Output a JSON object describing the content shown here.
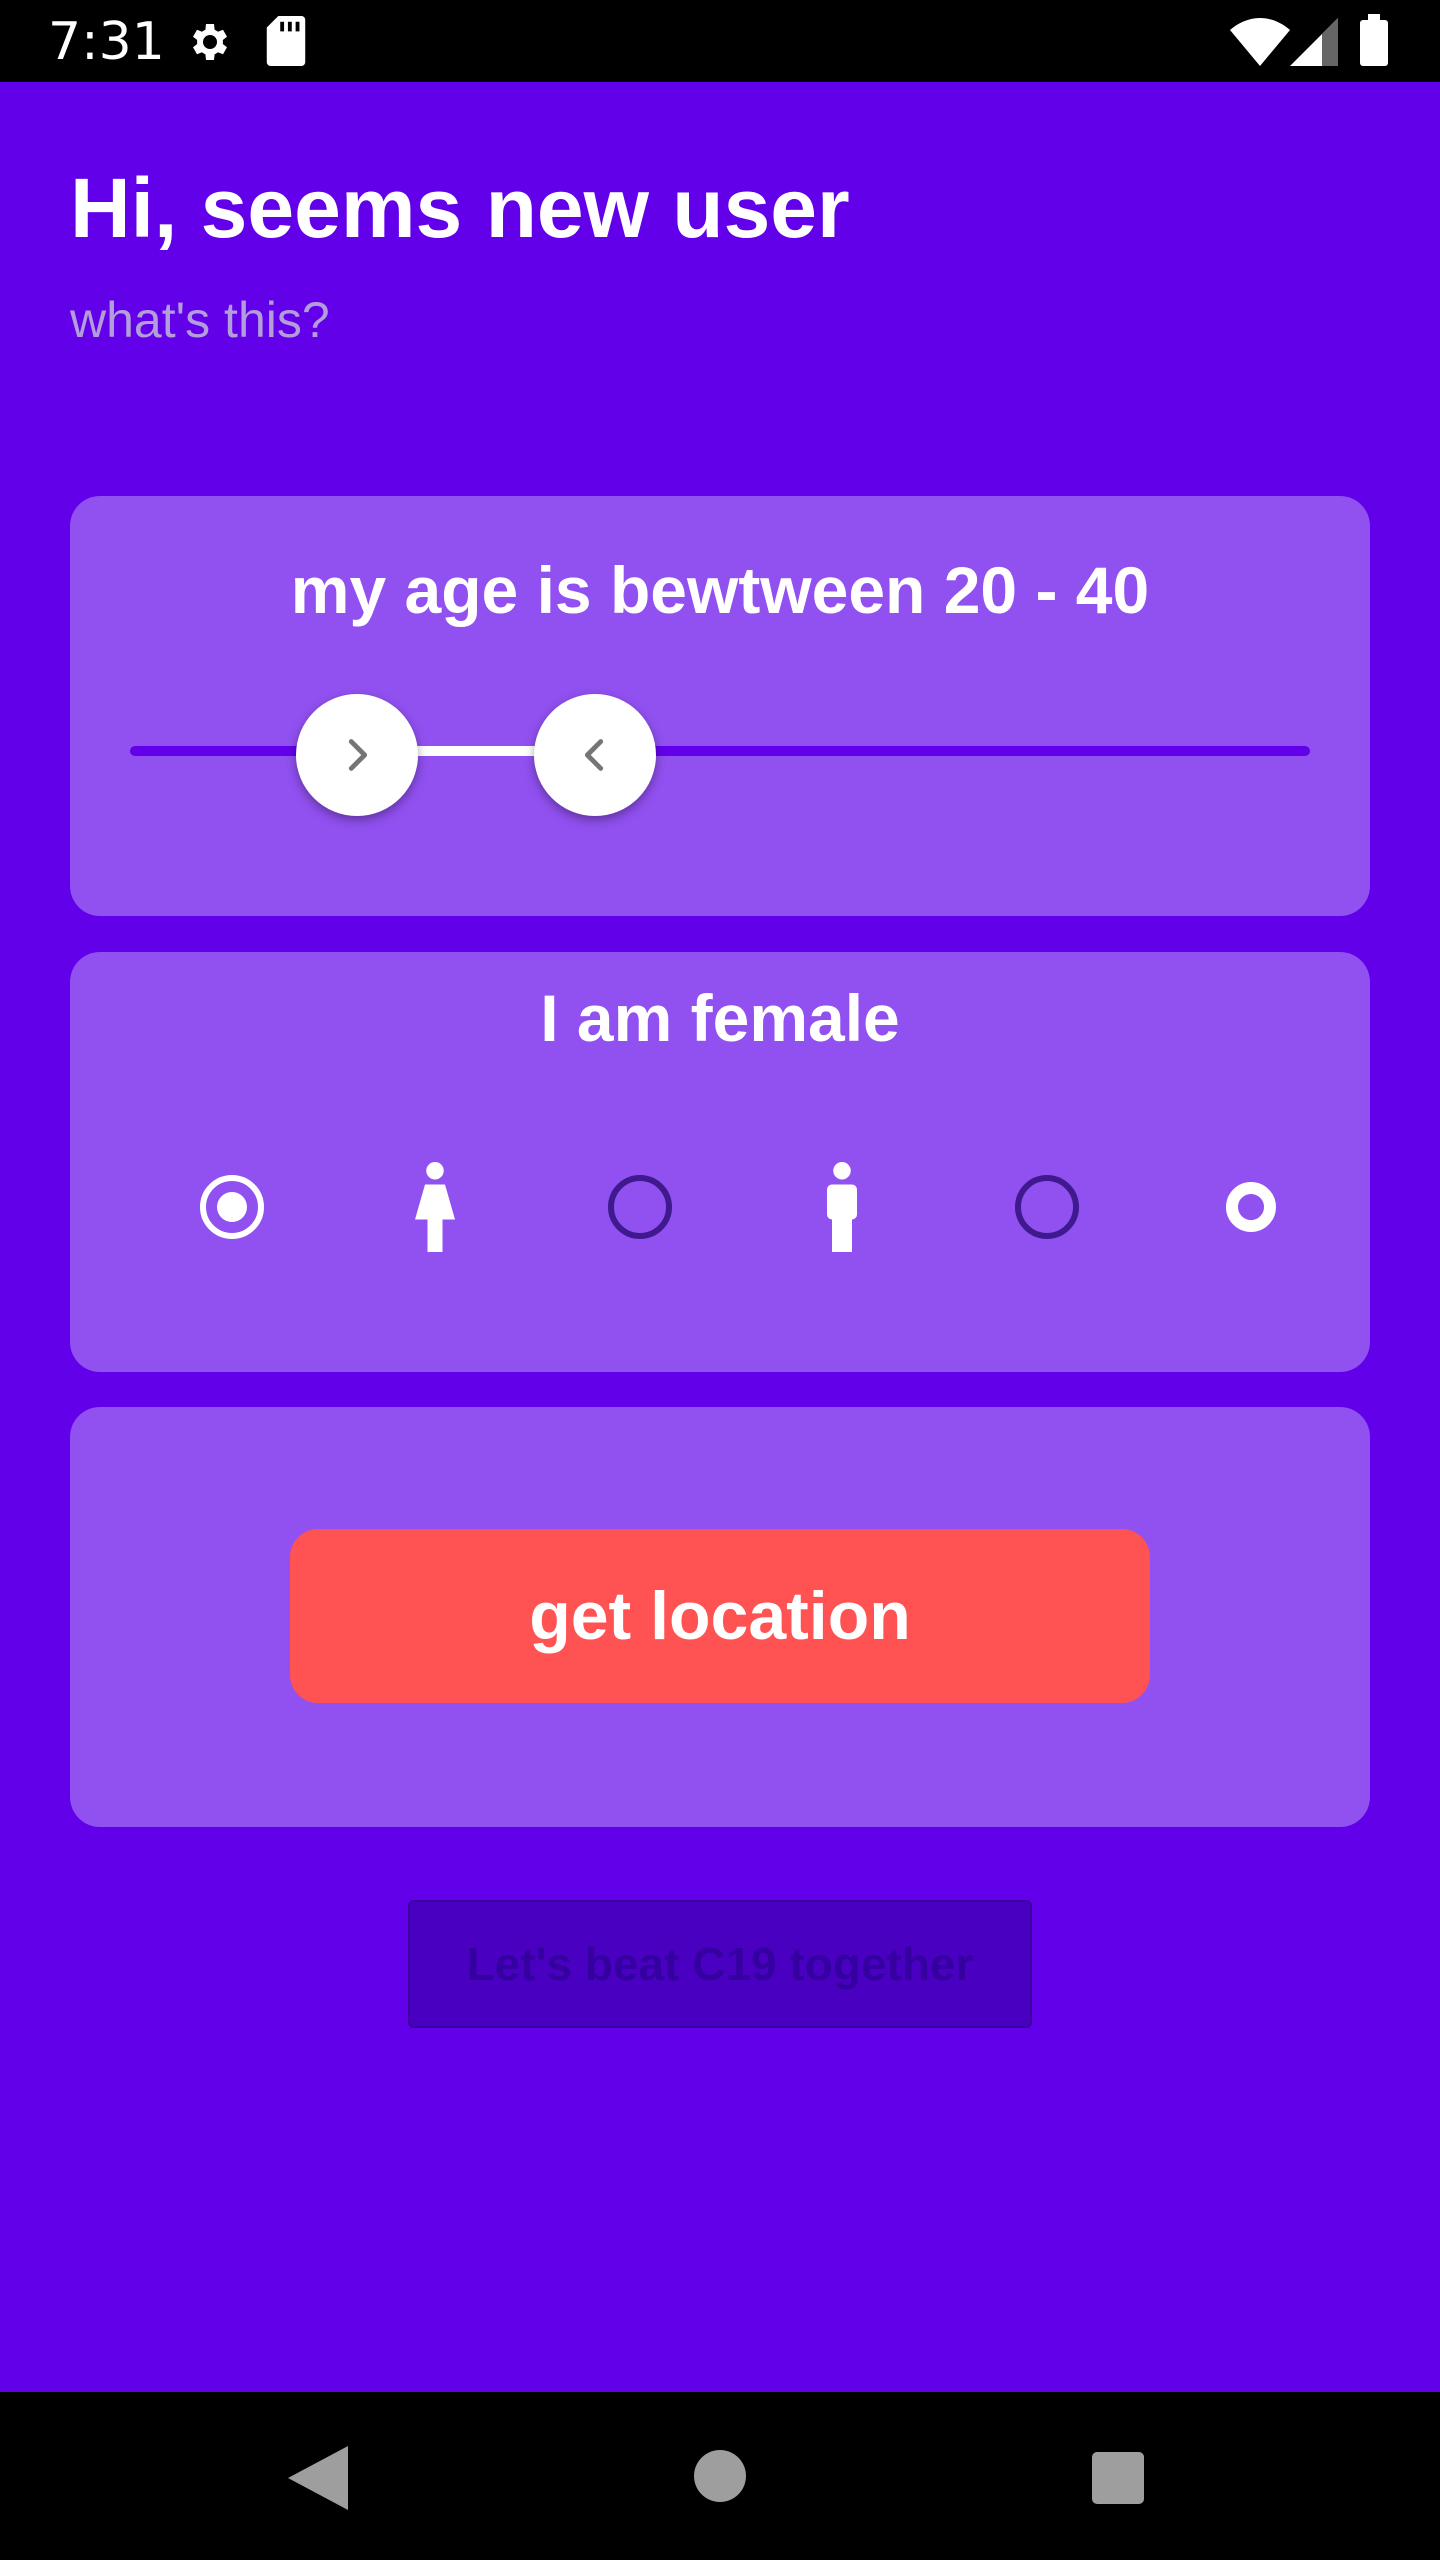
{
  "status_bar": {
    "time": "7:31",
    "icons": [
      "gear-icon",
      "sd-card-icon",
      "wifi-icon",
      "signal-icon",
      "battery-icon"
    ]
  },
  "header": {
    "title": "Hi, seems new user",
    "subtitle": "what's this?"
  },
  "age_card": {
    "label": "my age is bewtween 20 - 40",
    "range_min": 20,
    "range_max": 40,
    "thumb_left_icon": "chevron-right-icon",
    "thumb_right_icon": "chevron-left-icon"
  },
  "gender_card": {
    "label": "I am female",
    "options": [
      {
        "icon": "radio-selected",
        "selected": true
      },
      {
        "icon": "female-icon"
      },
      {
        "icon": "radio-unselected",
        "selected": false
      },
      {
        "icon": "male-icon"
      },
      {
        "icon": "radio-unselected",
        "selected": false
      },
      {
        "icon": "radio-other"
      }
    ]
  },
  "location_card": {
    "button_label": "get location"
  },
  "footer": {
    "label": "Let's beat C19 together"
  },
  "colors": {
    "background": "#6200EA",
    "card": "#9150F0",
    "button": "#FF5252",
    "footer_pill": "#4A00C0"
  },
  "nav_bar": {
    "icons": [
      "back-icon",
      "home-icon",
      "recents-icon"
    ]
  }
}
